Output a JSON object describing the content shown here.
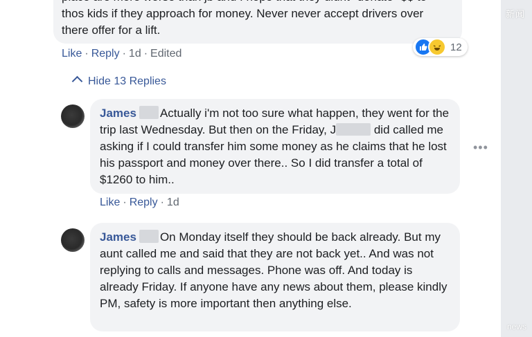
{
  "watermark_top": "新闻",
  "watermark_bottom": "news",
  "top_comment": {
    "lines": [
      "place are more worse than jb and I hope that they didnt \"donate\" $$ to",
      "thos kids if they approach for money. Never never accept drivers over",
      "there offer for a lift."
    ],
    "actions": {
      "like": "Like",
      "reply": "Reply",
      "time": "1d",
      "edited": "Edited"
    },
    "reactions": {
      "count": "12",
      "icons": [
        "like-icon",
        "haha-icon"
      ]
    }
  },
  "hide_replies_label": "Hide 13 Replies",
  "replies": [
    {
      "name": "James",
      "text_start": "Actually i'm not too sure what happen, they went for the trip last Wednesday. But then on the Friday, J",
      "text_end": " did called me asking if I could transfer him some money as he claims that he lost his passport and money over there.. So I did transfer a total of $1260 to him..",
      "actions": {
        "like": "Like",
        "reply": "Reply",
        "time": "1d"
      }
    },
    {
      "name": "James",
      "text": "On Monday itself they should be back already. But my aunt called me and said that they are not back yet.. And was not replying to calls and messages. Phone was off. And today is already Friday. If anyone have any news about them, please kindly PM, safety is more important then anything else."
    }
  ],
  "more_options": "•••",
  "colors": {
    "link": "#385898",
    "bubble": "#f2f3f5",
    "meta": "#606770"
  }
}
